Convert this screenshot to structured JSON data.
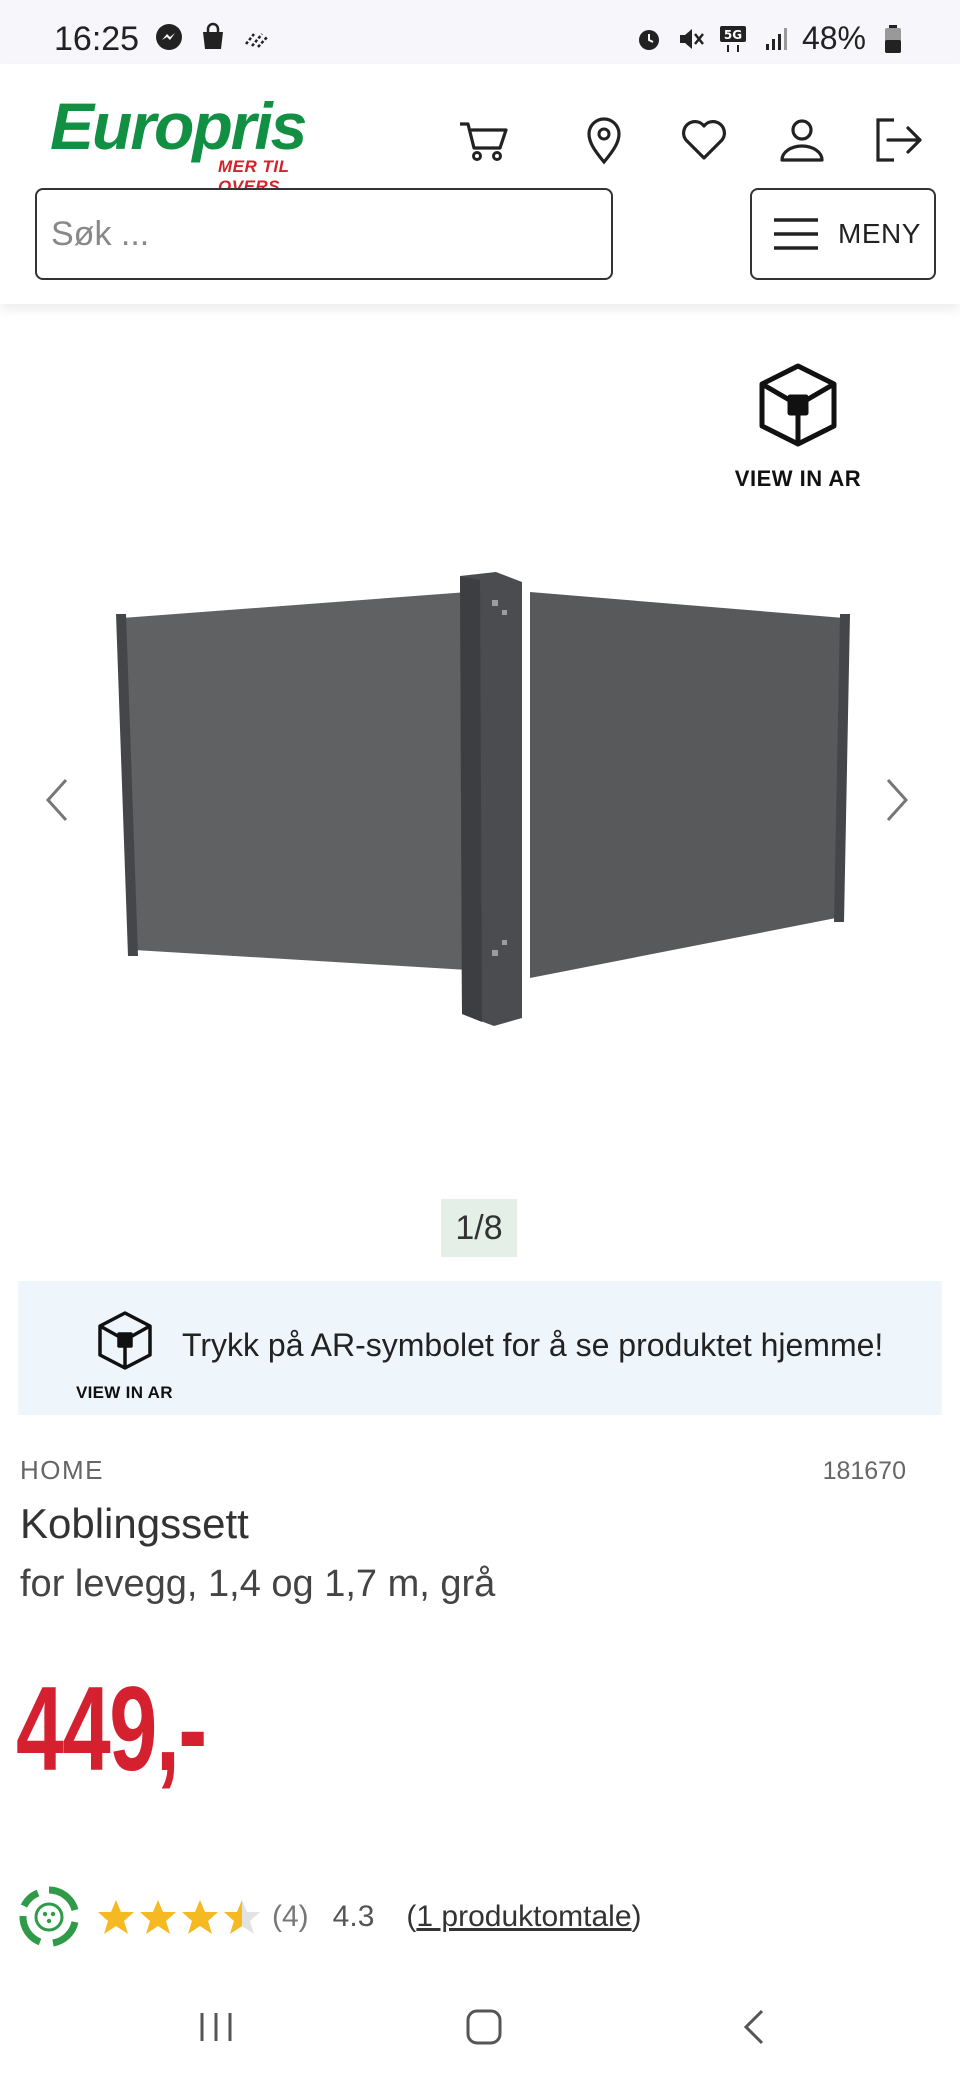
{
  "status_bar": {
    "time": "16:25",
    "battery": "48%",
    "icons": [
      "messenger-icon",
      "shopping-bag-icon",
      "signal-waves-icon",
      "alarm-icon",
      "mute-icon",
      "5g-icon",
      "signal-bars-icon",
      "battery-icon"
    ]
  },
  "header": {
    "logo_text": "Europris",
    "logo_tagline": "MER TIL OVERS",
    "search_placeholder": "Søk ...",
    "menu_label": "MENY",
    "icons": [
      "cart-icon",
      "location-pin-icon",
      "heart-icon",
      "user-icon",
      "logout-icon"
    ]
  },
  "gallery": {
    "ar_label": "VIEW IN AR",
    "counter": "1/8"
  },
  "ar_banner": {
    "label": "VIEW IN AR",
    "text": "Trykk på AR-symbolet for å se produktet hjemme!"
  },
  "product": {
    "brand": "HOME",
    "sku": "181670",
    "title": "Koblingssett",
    "subtitle": "for levegg, 1,4 og 1,7 m, grå",
    "price": "449,-"
  },
  "rating": {
    "stars": 3.5,
    "count": "(4)",
    "average": "4.3",
    "review_open": "(",
    "review_link": "1 produktomtale",
    "review_close": ")"
  },
  "colors": {
    "brand_green": "#119044",
    "brand_red": "#d6202b",
    "price_red": "#d4202f",
    "star_yellow": "#f5b921",
    "banner_bg": "#eef6fc"
  }
}
